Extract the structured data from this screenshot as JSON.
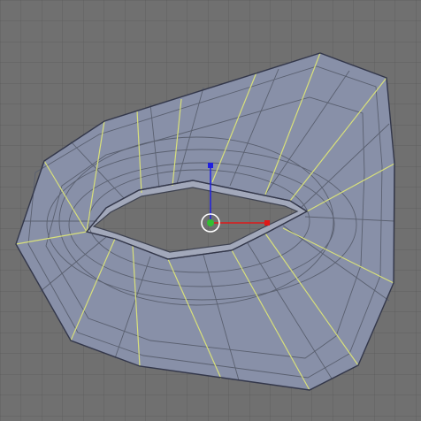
{
  "viewport": {
    "background": "#707070",
    "grid_color": "#5f5f5f",
    "mesh_fill": "#8890a8",
    "edge_color": "#3e4250",
    "wire_color": "#5a6070",
    "seam_color": "#d8e07a"
  },
  "manipulator": {
    "x_axis_color": "#e01818",
    "y_axis_color": "#2020e0",
    "origin_color": "#30c030",
    "ring_color": "#ffffff"
  },
  "icons": {
    "x_handle": "square-handle-icon",
    "y_handle": "square-handle-icon",
    "origin": "pivot-ring-icon"
  }
}
